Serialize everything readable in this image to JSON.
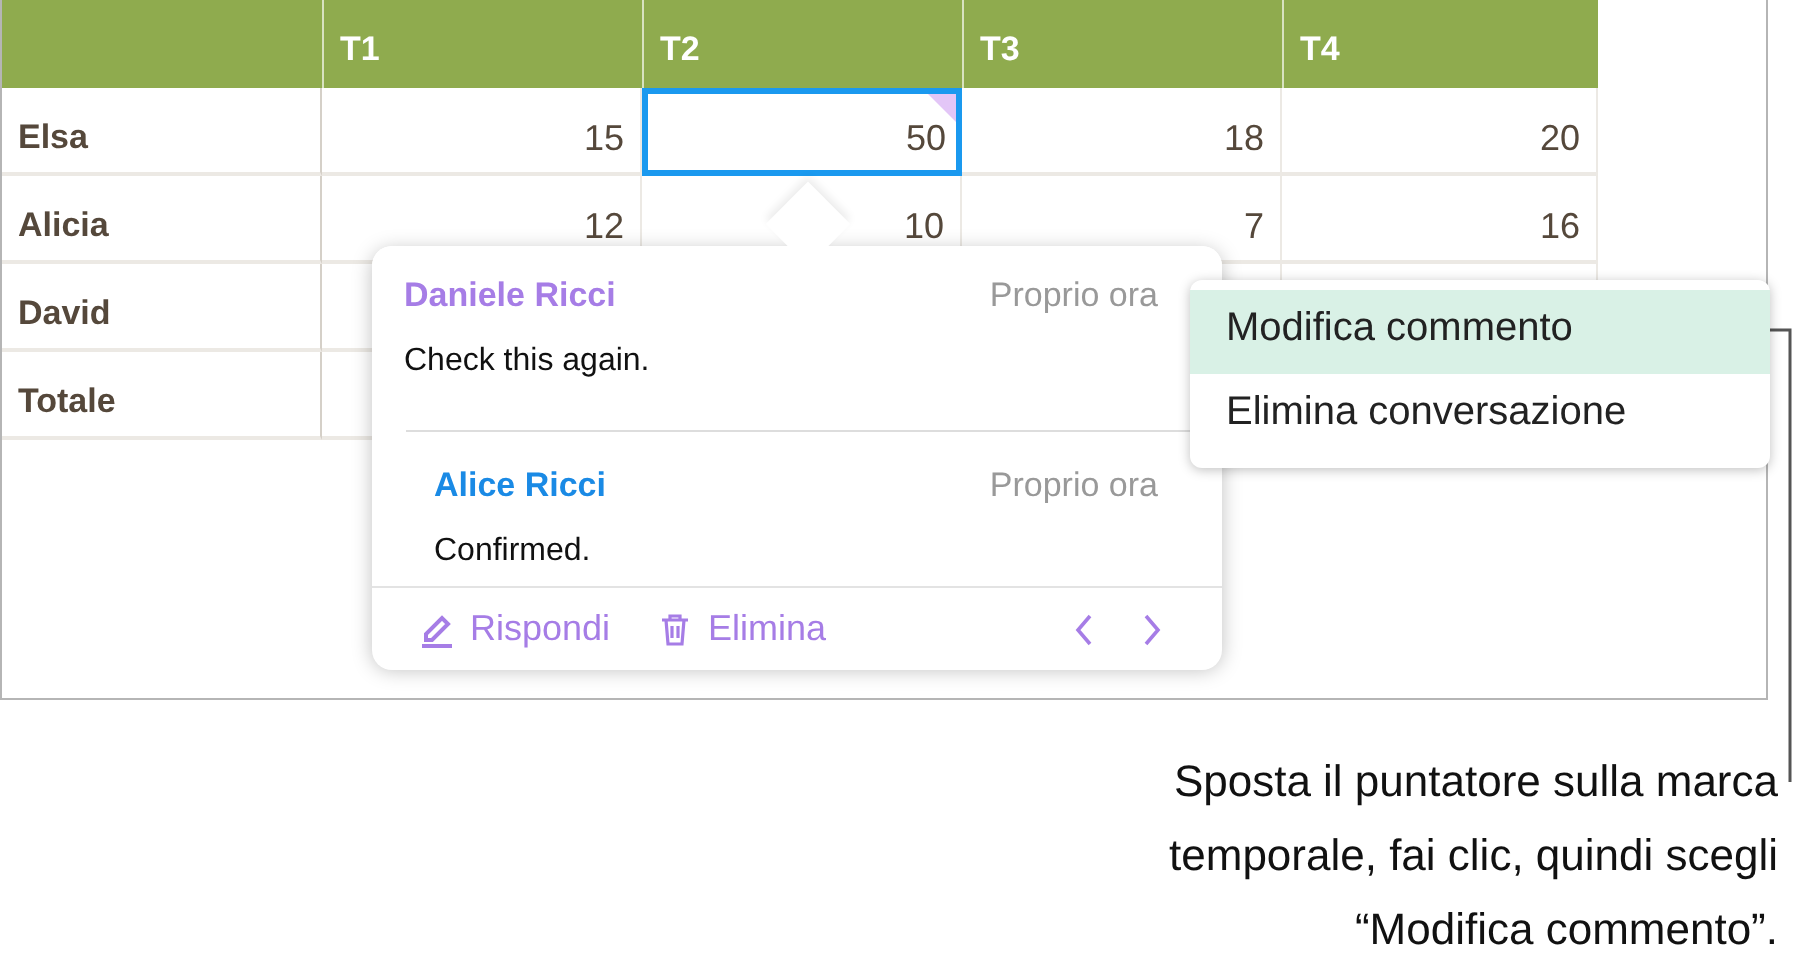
{
  "table": {
    "columns": [
      "T1",
      "T2",
      "T3",
      "T4"
    ],
    "rows": [
      {
        "label": "Elsa",
        "cells": [
          {
            "value": "15",
            "selected": false,
            "has_comment": false
          },
          {
            "value": "50",
            "selected": true,
            "has_comment": true
          },
          {
            "value": "18",
            "selected": false,
            "has_comment": false
          },
          {
            "value": "20",
            "selected": false,
            "has_comment": false
          }
        ]
      },
      {
        "label": "Alicia",
        "cells": [
          {
            "value": "12",
            "selected": false,
            "has_comment": false
          },
          {
            "value": "10",
            "selected": false,
            "has_comment": false
          },
          {
            "value": "7",
            "selected": false,
            "has_comment": false
          },
          {
            "value": "16",
            "selected": false,
            "has_comment": false
          }
        ]
      },
      {
        "label": "David"
      },
      {
        "label": "Totale"
      }
    ]
  },
  "comment_popover": {
    "comments": [
      {
        "author": "Daniele Ricci",
        "color": "#a67de6",
        "time": "Proprio ora",
        "text": "Check this again."
      },
      {
        "author": "Alice Ricci",
        "color": "#1a8ae5",
        "time": "Proprio ora",
        "text": "Confirmed."
      }
    ],
    "actions": [
      {
        "kind": "reply",
        "label": "Rispondi"
      },
      {
        "kind": "delete",
        "label": "Elimina"
      }
    ]
  },
  "context_menu": {
    "items": [
      {
        "label": "Modifica commento",
        "selected": true
      },
      {
        "label": "Elimina conversazione",
        "selected": false
      }
    ]
  },
  "callout": {
    "lines": [
      "Sposta il puntatore sulla marca",
      "temporale, fai clic, quindi scegli",
      "“Modifica commento”."
    ]
  }
}
